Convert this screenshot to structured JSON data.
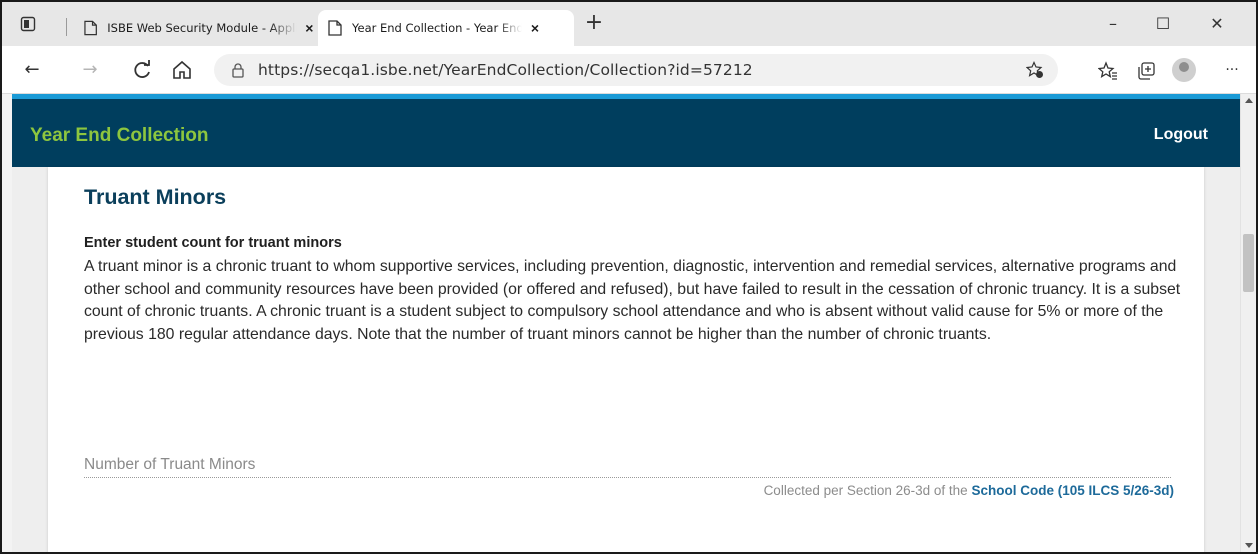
{
  "browser": {
    "tabs": [
      {
        "title": "ISBE Web Security Module - Application",
        "close": "×"
      },
      {
        "title": "Year End Collection - Year End Collection",
        "close": "×"
      }
    ],
    "new_tab": "+",
    "window_controls": {
      "minimize": "–",
      "maximize": "☐",
      "close": "✕"
    },
    "nav": {
      "back": "←",
      "forward": "→",
      "refresh": "C",
      "home": "⌂",
      "more": "···"
    },
    "url": "https://secqa1.isbe.net/YearEndCollection/Collection?id=57212",
    "icons": [
      "tab-actions-icon",
      "page-icon",
      "lock-icon",
      "add-favorite-icon",
      "favorites-icon",
      "collections-icon",
      "profile-avatar"
    ]
  },
  "app": {
    "title": "Year End Collection",
    "logout_label": "Logout",
    "colors": {
      "header": "#003e5e",
      "accent": "#1a9ad6",
      "title": "#8dc63f",
      "heading": "#0b3f5b",
      "link": "#1d6a9a"
    }
  },
  "section": {
    "heading": "Truant Minors",
    "subheading": "Enter student count for truant minors",
    "description": "A truant minor is a chronic truant to whom supportive services, including prevention, diagnostic, intervention and remedial services, alternative programs and other school and community resources have been provided (or offered and refused), but have failed to result in the cessation of chronic truancy. It is a subset count of chronic truants. A chronic truant is a student subject to compulsory school attendance and who is absent without valid cause for 5% or more of the previous 180 regular attendance days. Note that the number of truant minors cannot be higher than the number of chronic truants.",
    "field_label": "Number of Truant Minors",
    "field_value": "",
    "note_prefix": "Collected per Section 26-3d of the ",
    "note_link": "School Code (105 ILCS 5/26-3d)"
  }
}
